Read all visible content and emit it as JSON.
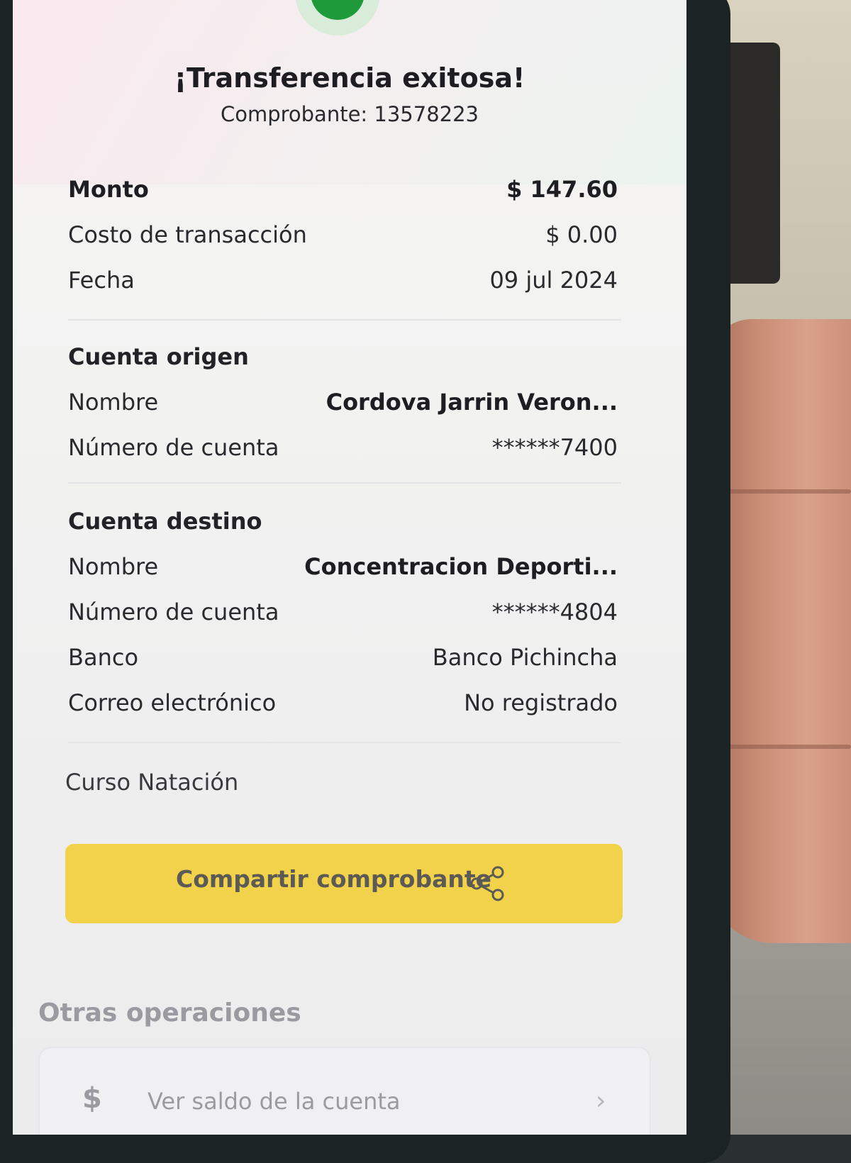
{
  "header": {
    "title": "¡Transferencia exitosa!",
    "subtitle": "Comprobante: 13578223"
  },
  "summary": [
    {
      "label": "Monto",
      "value": "$ 147.60"
    },
    {
      "label": "Costo de transacción",
      "value": "$ 0.00"
    },
    {
      "label": "Fecha",
      "value": "09 jul 2024"
    }
  ],
  "origin": {
    "title": "Cuenta origen",
    "rows": [
      {
        "label": "Nombre",
        "value": "Cordova  Jarrin Veron..."
      },
      {
        "label": "Número de cuenta",
        "value": "******7400"
      }
    ]
  },
  "destination": {
    "title": "Cuenta destino",
    "rows": [
      {
        "label": "Nombre",
        "value": "Concentracion Deporti..."
      },
      {
        "label": "Número de cuenta",
        "value": "******4804"
      },
      {
        "label": "Banco",
        "value": "Banco Pichincha"
      },
      {
        "label": "Correo electrónico",
        "value": "No registrado"
      }
    ]
  },
  "note": "Curso Natación",
  "share_button": {
    "label": "Compartir comprobante",
    "icon": "share-icon"
  },
  "other_operations": {
    "title": "Otras operaciones",
    "items": [
      {
        "icon": "dollar-icon",
        "icon_glyph": "$",
        "label": "Ver saldo de la cuenta",
        "chevron": "›"
      }
    ]
  },
  "colors": {
    "accent": "#f2d24a",
    "success": "#1f9a3a"
  }
}
